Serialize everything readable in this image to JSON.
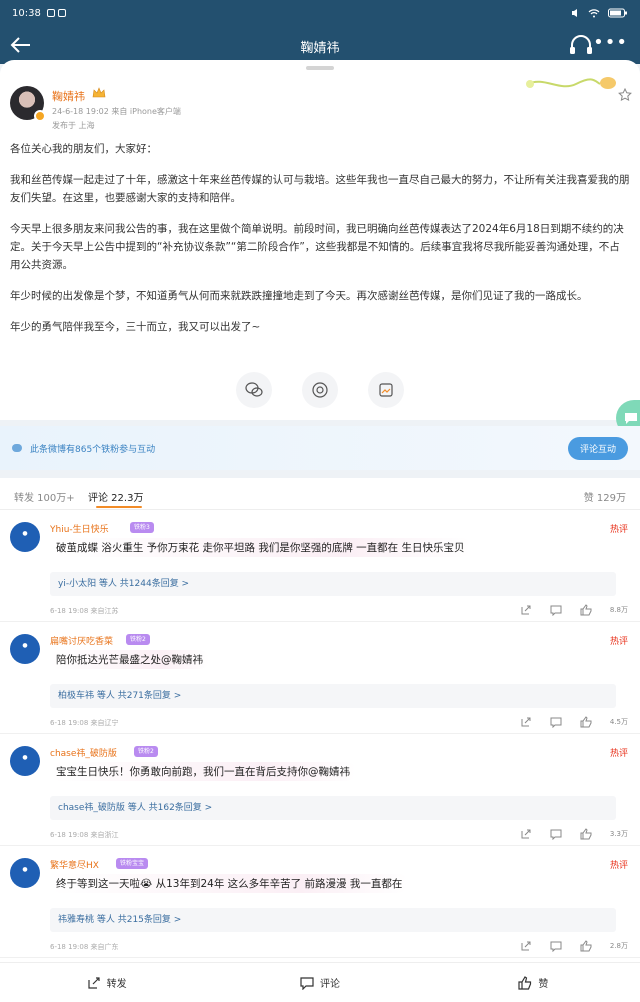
{
  "status_bar": {
    "time": "10:38"
  },
  "nav": {
    "title": "鞠婧祎"
  },
  "post": {
    "author": "鞠婧祎",
    "meta": "24-6-18 19:02  来自 iPhone客户端",
    "location": "发布于 上海",
    "paragraphs": [
      "各位关心我的朋友们，大家好：",
      "我和丝芭传媒一起走过了十年，感激这十年来丝芭传媒的认可与栽培。这些年我也一直尽自己最大的努力，不让所有关注我喜爱我的朋友们失望。在这里，也要感谢大家的支持和陪伴。",
      "今天早上很多朋友来问我公告的事，我在这里做个简单说明。前段时间，我已明确向丝芭传媒表达了2024年6月18日到期不续约的决定。关于今天早上公告中提到的“补充协议条款”“第二阶段合作”，这些我都是不知情的。后续事宜我将尽我所能妥善沟通处理，不占用公共资源。",
      "年少时候的出发像是个梦，不知道勇气从何而来就跌跌撞撞地走到了今天。再次感谢丝芭传媒，是你们见证了我的一路成长。",
      "年少的勇气陪伴我至今，三十而立，我又可以出发了~"
    ]
  },
  "fans_banner": {
    "text": "此条微博有865个铁粉参与互动",
    "button": "评论互动"
  },
  "tabs": {
    "repost": "转发 100万+",
    "comment": "评论 22.3万",
    "likes": "赞 129万"
  },
  "comments": [
    {
      "user": "Yhiu-生日快乐",
      "level": "铁粉3",
      "hot": "热评",
      "text": "破茧成蝶 浴火重生 予你万束花 走你平坦路 我们是你坚强的底牌 一直都在 生日快乐宝贝",
      "replies": "yi-小太阳 等人 共1244条回复 >",
      "time": "6-18 19:08  来自江苏",
      "likes": "8.8万"
    },
    {
      "user": "扁嘴讨厌吃香菜",
      "level": "铁粉2",
      "hot": "热评",
      "text": "陪你抵达光芒最盛之处@鞠婧祎",
      "replies": "柏极车祎 等人 共271条回复 >",
      "time": "6-18 19:08  来自辽宁",
      "likes": "4.5万"
    },
    {
      "user": "chase祎_破防版",
      "level": "铁粉2",
      "hot": "热评",
      "text": "宝宝生日快乐！你勇敢向前跑，我们一直在背后支持你@鞠婧祎",
      "replies": "chase祎_破防版 等人 共162条回复 >",
      "time": "6-18 19:08  来自浙江",
      "likes": "3.3万"
    },
    {
      "user": "繁华意尽HX",
      "level": "铁粉宝宝",
      "hot": "热评",
      "text": "终于等到这一天啦😭 从13年到24年 这么多年辛苦了 前路漫漫 我一直都在",
      "replies": "祎雅寿桃 等人 共215条回复 >",
      "time": "6-18 19:08  来自广东",
      "likes": "2.8万"
    }
  ],
  "bottom_bar": {
    "repost": "转发",
    "comment": "评论",
    "like": "赞"
  },
  "colors": {
    "header": "#23506f",
    "accent": "#f28c28",
    "link": "#3b6ea0",
    "hot": "#e8301a"
  }
}
